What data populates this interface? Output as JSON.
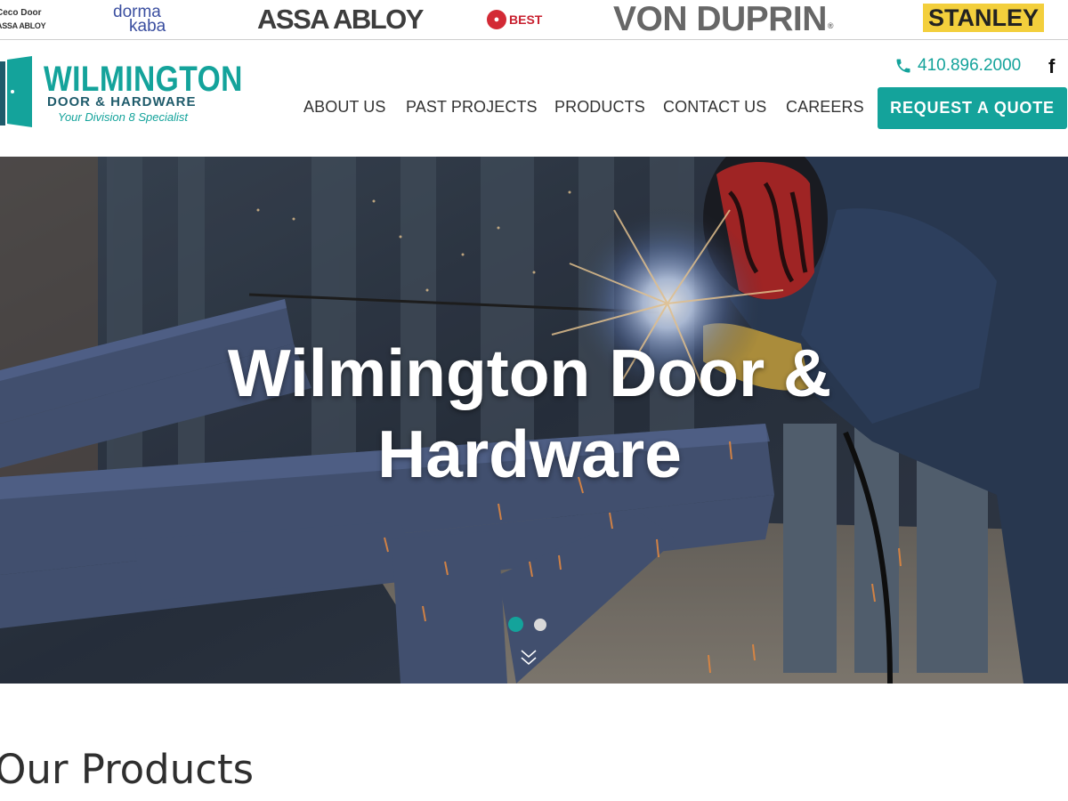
{
  "brands": {
    "ceco_line1": "Ceco Door",
    "ceco_line2": "ASSA ABLOY",
    "dormakaba_line1": "dorma",
    "dormakaba_line2": "kaba",
    "assa_abloy": "ASSA ABLOY",
    "best": "BEST",
    "von_duprin": "VON DUPRIN",
    "stanley": "STANLEY"
  },
  "header": {
    "logo_name": "WILMINGTON",
    "logo_sub": "DOOR & HARDWARE",
    "logo_tagline": "Your Division 8 Specialist",
    "phone": "410.896.2000",
    "facebook_glyph": "f",
    "nav": [
      "ABOUT US",
      "PAST PROJECTS",
      "PRODUCTS",
      "CONTACT US",
      "CAREERS"
    ],
    "cta_label": "REQUEST A QUOTE"
  },
  "hero": {
    "title_line1": "Wilmington Door &",
    "title_line2": "Hardware",
    "slides_total": 2,
    "active_slide": 1
  },
  "sections": {
    "products_title": "Our Products"
  },
  "colors": {
    "accent": "#14a39b",
    "text": "#333333"
  },
  "icons": [
    "phone-icon",
    "facebook-icon",
    "chevron-down-icon",
    "door-logo-icon"
  ]
}
